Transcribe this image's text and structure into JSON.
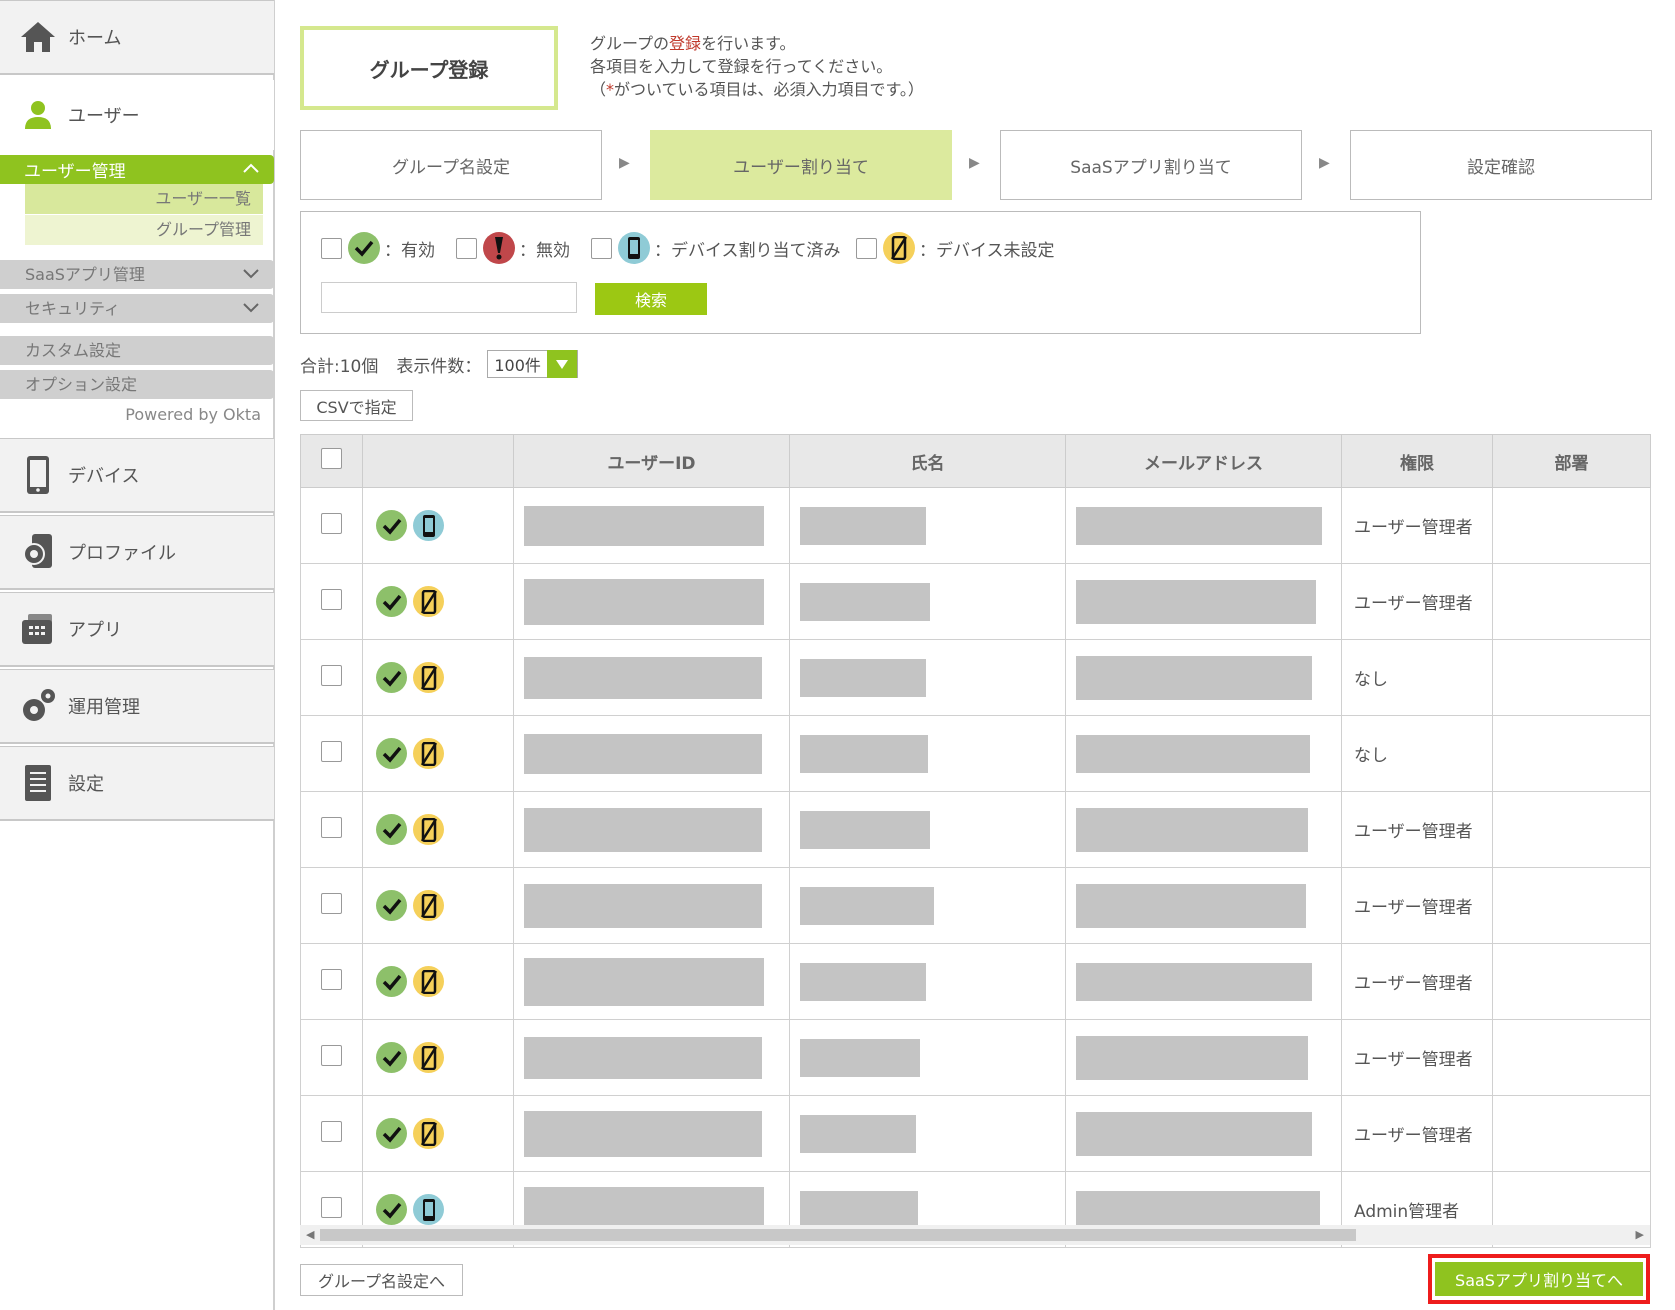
{
  "sidebar": {
    "home": "ホーム",
    "user": "ユーザー",
    "user_mgmt": "ユーザー管理",
    "user_list": "ユーザー一覧",
    "group_mgmt": "グループ管理",
    "saas_mgmt": "SaaSアプリ管理",
    "security": "セキュリティ",
    "custom": "カスタム設定",
    "option": "オプション設定",
    "powered": "Powered by Okta",
    "device": "デバイス",
    "profile": "プロファイル",
    "app": "アプリ",
    "ops": "運用管理",
    "settings": "設定"
  },
  "header": {
    "title": "グループ登録",
    "desc1_a": "グループの",
    "desc1_red": "登録",
    "desc1_b": "を行います。",
    "desc2": "各項目を入力して登録を行ってください。",
    "desc3_a": "（",
    "desc3_red": "*",
    "desc3_b": "がついている項目は、必須入力項目です。）"
  },
  "steps": [
    "グループ名設定",
    "ユーザー割り当て",
    "SaaSアプリ割り当て",
    "設定確認"
  ],
  "filter": {
    "valid": "：有効",
    "invalid": "：無効",
    "assigned": "：デバイス割り当て済み",
    "unset": "：デバイス未設定",
    "search_btn": "検索"
  },
  "list": {
    "total": "合計:10個",
    "per_page_label": "表示件数：",
    "per_page_value": "100件",
    "csv_btn": "CSVで指定"
  },
  "table": {
    "headers": [
      "",
      "",
      "ユーザーID",
      "氏名",
      "メールアドレス",
      "権限",
      "部署"
    ],
    "rows": [
      {
        "device": "assigned",
        "role": "ユーザー管理者"
      },
      {
        "device": "unset",
        "role": "ユーザー管理者"
      },
      {
        "device": "unset",
        "role": "なし"
      },
      {
        "device": "unset",
        "role": "なし"
      },
      {
        "device": "unset",
        "role": "ユーザー管理者"
      },
      {
        "device": "unset",
        "role": "ユーザー管理者"
      },
      {
        "device": "unset",
        "role": "ユーザー管理者"
      },
      {
        "device": "unset",
        "role": "ユーザー管理者"
      },
      {
        "device": "unset",
        "role": "ユーザー管理者"
      },
      {
        "device": "assigned",
        "role": "Admin管理者"
      }
    ]
  },
  "footer": {
    "back_btn": "グループ名設定へ",
    "next_btn": "SaaSアプリ割り当てへ"
  },
  "colors": {
    "accent": "#8fc31f",
    "valid_badge": "#8dc06a",
    "invalid_badge": "#c0474a",
    "assigned_badge": "#8fcbd6",
    "unset_badge": "#f5d05a",
    "highlight": "#ee1c1c"
  }
}
